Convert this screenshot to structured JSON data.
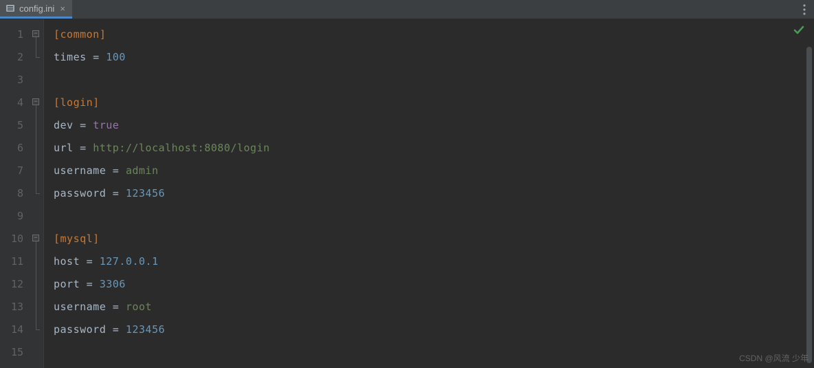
{
  "tab": {
    "filename": "config.ini",
    "close_glyph": "×"
  },
  "lines": [
    {
      "n": 1,
      "fold": "start",
      "tokens": [
        {
          "t": "[common]",
          "c": "section"
        }
      ]
    },
    {
      "n": 2,
      "fold": "end",
      "tokens": [
        {
          "t": "times",
          "c": "key"
        },
        {
          "t": " = ",
          "c": "eq"
        },
        {
          "t": "100",
          "c": "number"
        }
      ]
    },
    {
      "n": 3,
      "fold": "",
      "tokens": []
    },
    {
      "n": 4,
      "fold": "start",
      "tokens": [
        {
          "t": "[login]",
          "c": "section"
        }
      ]
    },
    {
      "n": 5,
      "fold": "mid",
      "tokens": [
        {
          "t": "dev",
          "c": "key"
        },
        {
          "t": " = ",
          "c": "eq"
        },
        {
          "t": "true",
          "c": "bool"
        }
      ]
    },
    {
      "n": 6,
      "fold": "mid",
      "tokens": [
        {
          "t": "url",
          "c": "key"
        },
        {
          "t": " = ",
          "c": "eq"
        },
        {
          "t": "http://localhost:8080/login",
          "c": "string"
        }
      ]
    },
    {
      "n": 7,
      "fold": "mid",
      "tokens": [
        {
          "t": "username",
          "c": "key"
        },
        {
          "t": " = ",
          "c": "eq"
        },
        {
          "t": "admin",
          "c": "string"
        }
      ]
    },
    {
      "n": 8,
      "fold": "end",
      "tokens": [
        {
          "t": "password",
          "c": "key"
        },
        {
          "t": " = ",
          "c": "eq"
        },
        {
          "t": "123456",
          "c": "number"
        }
      ]
    },
    {
      "n": 9,
      "fold": "",
      "tokens": []
    },
    {
      "n": 10,
      "fold": "start",
      "tokens": [
        {
          "t": "[mysql]",
          "c": "section"
        }
      ]
    },
    {
      "n": 11,
      "fold": "mid",
      "tokens": [
        {
          "t": "host",
          "c": "key"
        },
        {
          "t": " = ",
          "c": "eq"
        },
        {
          "t": "127.0.0.1",
          "c": "number"
        }
      ]
    },
    {
      "n": 12,
      "fold": "mid",
      "tokens": [
        {
          "t": "port",
          "c": "key"
        },
        {
          "t": " = ",
          "c": "eq"
        },
        {
          "t": "3306",
          "c": "number"
        }
      ]
    },
    {
      "n": 13,
      "fold": "mid",
      "tokens": [
        {
          "t": "username",
          "c": "key"
        },
        {
          "t": " = ",
          "c": "eq"
        },
        {
          "t": "root",
          "c": "string"
        }
      ]
    },
    {
      "n": 14,
      "fold": "end",
      "tokens": [
        {
          "t": "password",
          "c": "key"
        },
        {
          "t": " = ",
          "c": "eq"
        },
        {
          "t": "123456",
          "c": "number"
        }
      ]
    },
    {
      "n": 15,
      "fold": "",
      "tokens": []
    }
  ],
  "watermark": "CSDN @风流 少年"
}
